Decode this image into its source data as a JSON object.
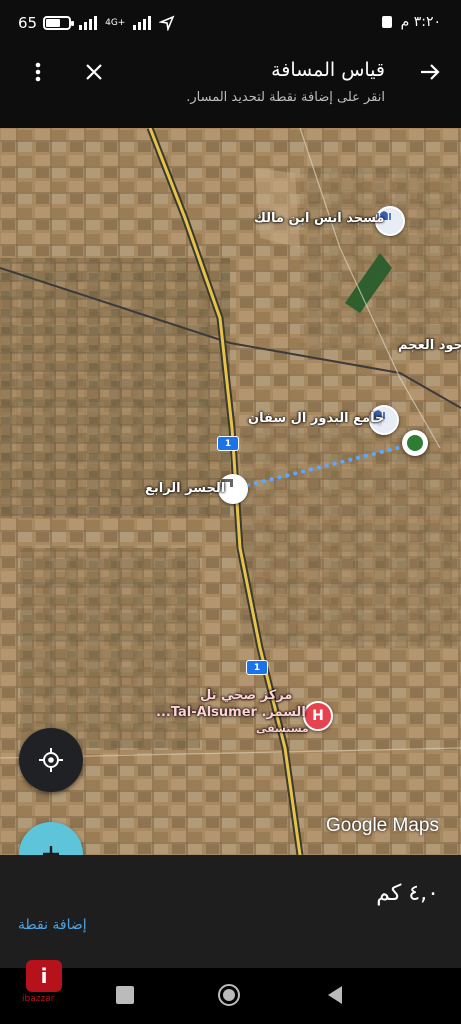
{
  "status_bar": {
    "battery": "65",
    "battery_level": 0.65,
    "network": "4G+",
    "time": "٣:٢٠ م"
  },
  "app_bar": {
    "title": "قياس المسافة",
    "subtitle": "انقر على إضافة نقطة لتحديد المسار.",
    "icons": [
      "more-vert-icon",
      "close-icon",
      "arrow-forward-icon"
    ]
  },
  "map": {
    "labels": {
      "mosque_anas": "مسجد انس ابن مالك",
      "jood_alajam": "جود العجم",
      "mosque_badour": "جامع البدور ال سفان",
      "bridge4": "الجسر الرابع",
      "health_line1": "مركز صحي تل",
      "health_line2": "السمر. Tal-Alsumer...",
      "health_line3": "مستشفى"
    },
    "road_shield_1": "1",
    "road_shield_2": "1",
    "watermark": "Google Maps"
  },
  "controls": {
    "locate_icon": "my-location-icon",
    "add_icon": "add-icon"
  },
  "bottom_panel": {
    "distance": "٤,٠ كم",
    "add_point_label": "إضافة نقطة"
  },
  "system_nav": {
    "buttons": [
      "recents-icon",
      "home-icon",
      "back-icon"
    ],
    "brand_logo_text": "i",
    "brand_caption": "ibazzar"
  },
  "colors": {
    "appbar_bg": "#0d0d0d",
    "fab_add": "#5ec4d9",
    "link_blue": "#4fa3e0",
    "route_dots": "#5aa8ff",
    "endpoint_green": "#2e7d32"
  }
}
